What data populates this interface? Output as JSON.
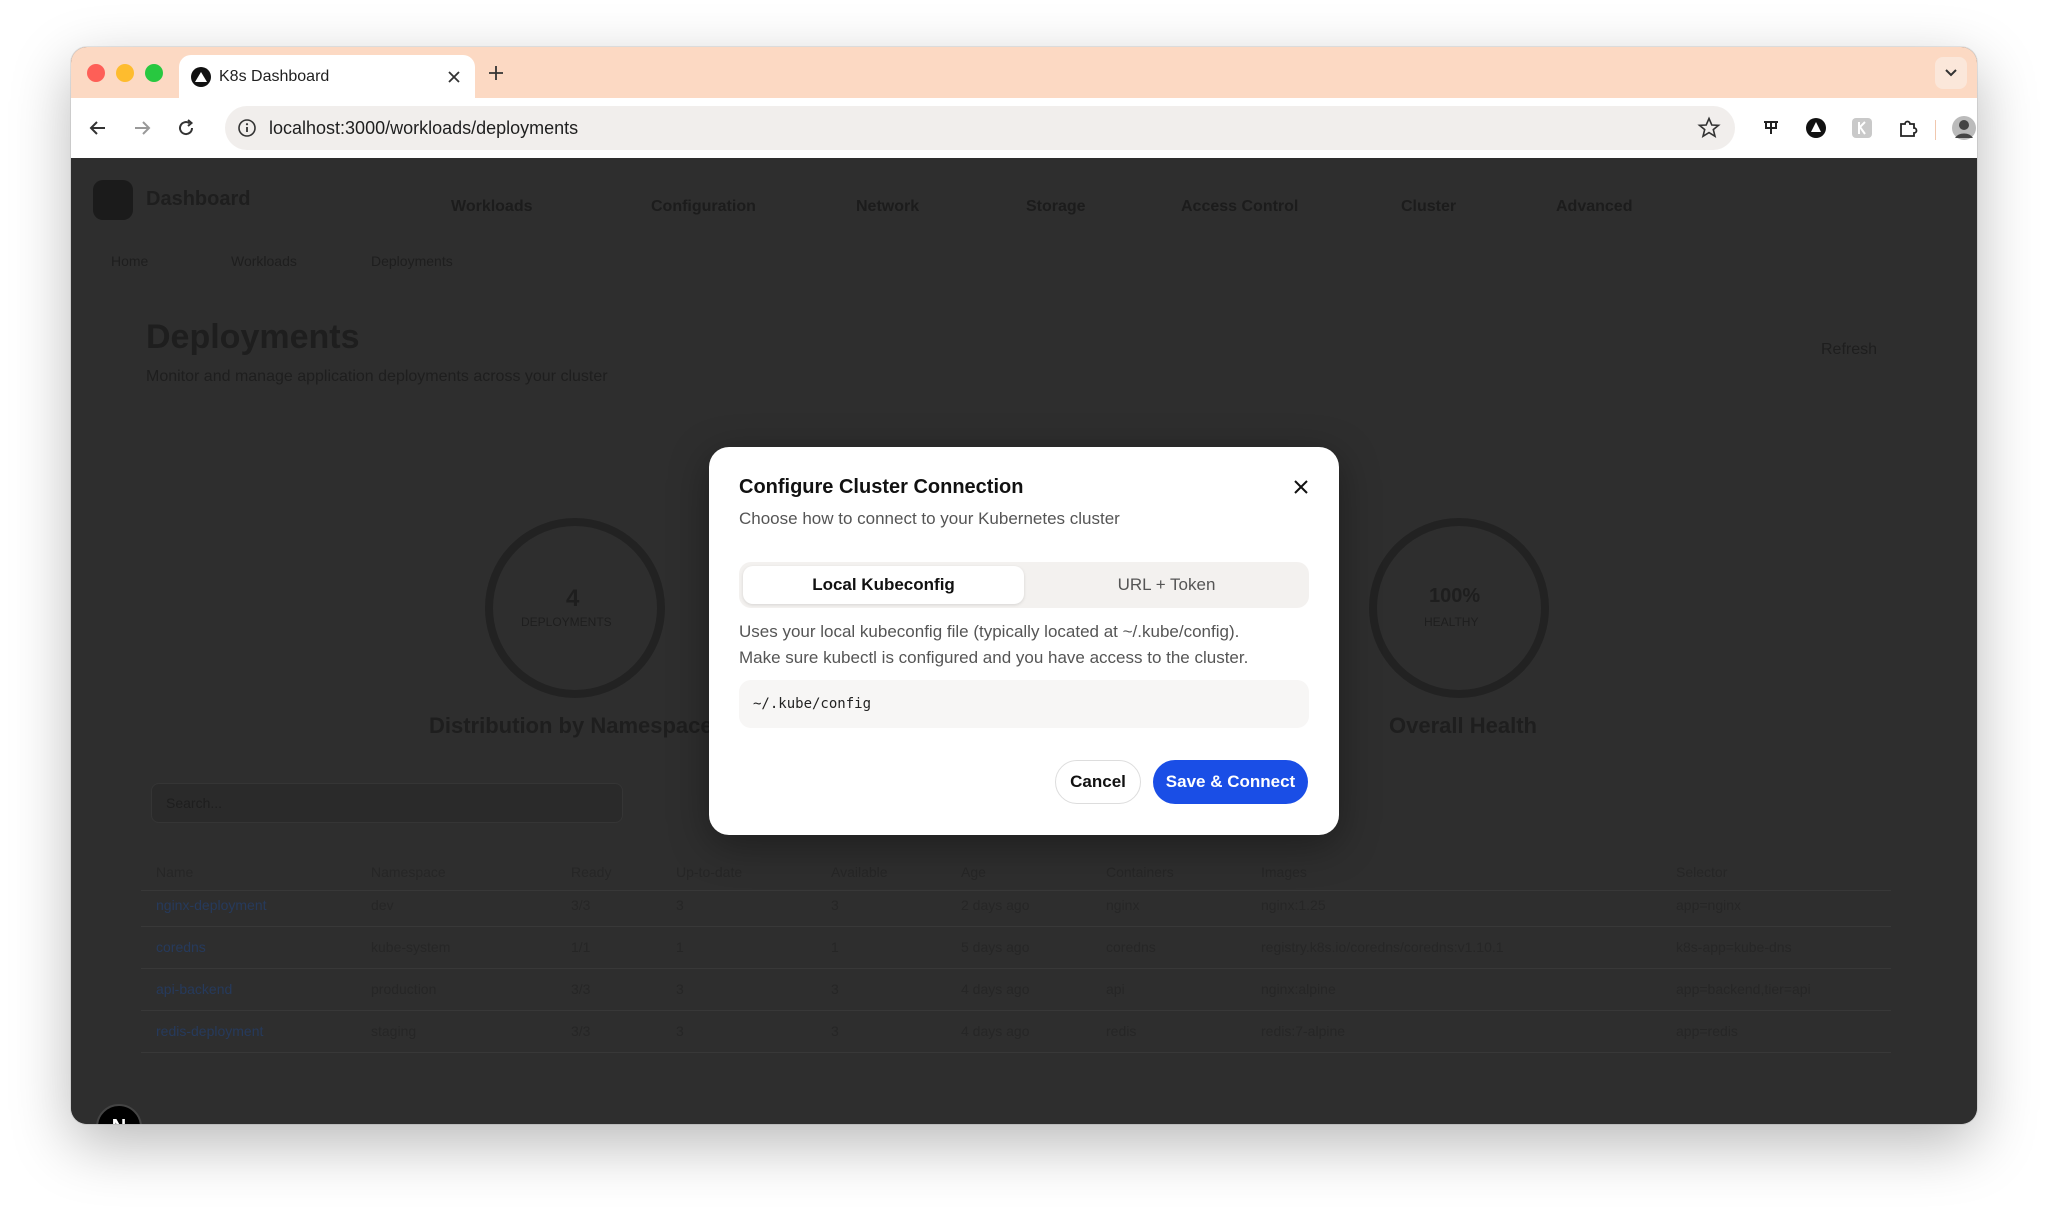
{
  "browser": {
    "tab_title": "K8s Dashboard",
    "url": "localhost:3000/workloads/deployments"
  },
  "background": {
    "brand": "Dashboard",
    "nav": [
      "Workloads",
      "Configuration",
      "Network",
      "Storage",
      "Access Control",
      "Cluster",
      "Advanced"
    ],
    "breadcrumb": [
      "Home",
      "Workloads",
      "Deployments"
    ],
    "page_title": "Deployments",
    "page_subtitle": "Monitor and manage application deployments across your cluster",
    "refresh_label": "Refresh",
    "ring_left_value": "4",
    "ring_left_caption": "DEPLOYMENTS",
    "ring_right_value": "100%",
    "ring_right_caption": "HEALTHY",
    "section_left": "Distribution by Namespace",
    "section_right": "Overall Health",
    "search_placeholder": "Search...",
    "table_headers": [
      "Name",
      "Namespace",
      "Ready",
      "Up-to-date",
      "Available",
      "Age",
      "Containers",
      "Images",
      "Selector"
    ],
    "rows": [
      [
        "nginx-deployment",
        "dev",
        "3/3",
        "3",
        "3",
        "2 days ago",
        "nginx",
        "nginx:1.25",
        "app=nginx"
      ],
      [
        "coredns",
        "kube-system",
        "1/1",
        "1",
        "1",
        "5 days ago",
        "coredns",
        "registry.k8s.io/coredns/coredns:v1.10.1",
        "k8s-app=kube-dns"
      ],
      [
        "api-backend",
        "production",
        "3/3",
        "3",
        "3",
        "4 days ago",
        "api",
        "nginx:alpine",
        "app=backend,tier=api"
      ],
      [
        "redis-deployment",
        "staging",
        "3/3",
        "3",
        "3",
        "4 days ago",
        "redis",
        "redis:7-alpine",
        "app=redis"
      ]
    ]
  },
  "modal": {
    "title": "Configure Cluster Connection",
    "subtitle": "Choose how to connect to your Kubernetes cluster",
    "tab_local": "Local Kubeconfig",
    "tab_url": "URL + Token",
    "description_line1": "Uses your local kubeconfig file (typically located at ~/.kube/config).",
    "description_line2": "Make sure kubectl is configured and you have access to the cluster.",
    "kubeconfig_path": "~/.kube/config",
    "cancel_label": "Cancel",
    "save_label": "Save & Connect"
  },
  "next_badge": "N",
  "colors": {
    "accent": "#1a4ee6",
    "tabstrip": "#fcd9c3",
    "overlay": "#2e2e2e"
  }
}
